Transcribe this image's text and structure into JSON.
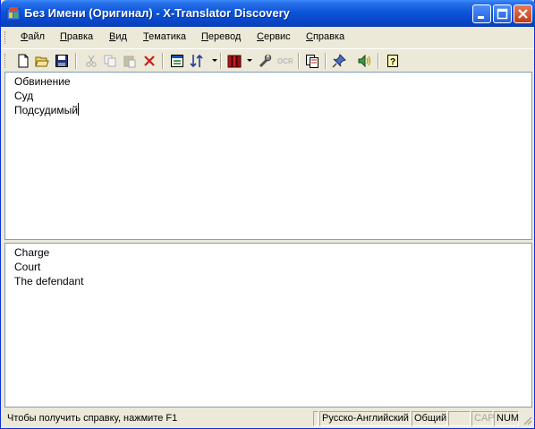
{
  "window": {
    "title": "Без Имени (Оригинал) - X-Translator Discovery"
  },
  "menu": {
    "items": [
      "Файл",
      "Правка",
      "Вид",
      "Тематика",
      "Перевод",
      "Сервис",
      "Справка"
    ]
  },
  "toolbar": {
    "icons": [
      "new-document",
      "open-folder",
      "save-disk",
      "cut-scissors",
      "copy",
      "paste",
      "delete-x",
      "translate-window",
      "direction-sort",
      "dictionary-books",
      "tools-wrench",
      "ocr",
      "documents",
      "pin",
      "speaker",
      "help-question"
    ]
  },
  "source_pane": {
    "lines": [
      "Обвинение",
      "Суд",
      "Подсудимый"
    ]
  },
  "target_pane": {
    "lines": [
      "Charge",
      "Court",
      "The defendant"
    ]
  },
  "statusbar": {
    "hint": "Чтобы получить справку, нажмите F1",
    "direction": "Русско-Английский",
    "topic": "Общий",
    "empty_cell": "",
    "cap": "CAP",
    "num": "NUM"
  },
  "colors": {
    "titlebar": "#0A55D9",
    "chrome": "#ECE9D8",
    "pane_border": "#7F9DB9"
  }
}
